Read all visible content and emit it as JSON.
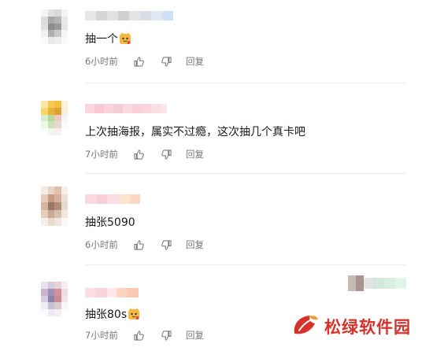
{
  "comments": [
    {
      "text": "抽一个",
      "has_emoji": true,
      "time": "6小时前",
      "reply_label": "回复"
    },
    {
      "text": "上次抽海报，属实不过瘾，这次抽几个真卡吧",
      "has_emoji": false,
      "time": "7小时前",
      "reply_label": "回复"
    },
    {
      "text": "抽张5090",
      "has_emoji": false,
      "time": "6小时前",
      "reply_label": "回复"
    },
    {
      "text": "抽张80s",
      "has_emoji": true,
      "time": "7小时前",
      "reply_label": "回复"
    }
  ],
  "icons": {
    "like": "thumbs-up-icon",
    "dislike": "thumbs-down-icon",
    "emoji": "cat-emoji-icon"
  },
  "watermark": {
    "text": "松绿软件园",
    "color": "#d6322b"
  },
  "colors": {
    "meta_text": "#777777",
    "divider": "#ececec"
  }
}
